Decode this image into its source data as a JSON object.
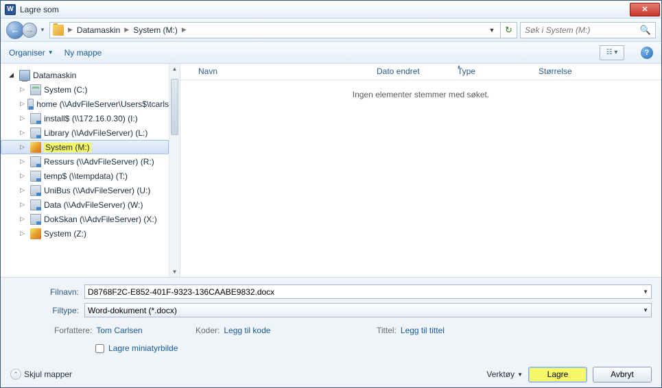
{
  "window": {
    "title": "Lagre som",
    "app_icon_letter": "W"
  },
  "nav": {
    "breadcrumb": [
      "Datamaskin",
      "System (M:)"
    ],
    "search_placeholder": "Søk i System (M:)"
  },
  "toolbar": {
    "organize": "Organiser",
    "new_folder": "Ny mappe"
  },
  "tree": {
    "root": "Datamaskin",
    "items": [
      {
        "label": "System (C:)",
        "icon": "drive"
      },
      {
        "label": "home (\\\\AdvFileServer\\Users$\\tcarls",
        "icon": "netdrive"
      },
      {
        "label": "install$ (\\\\172.16.0.30) (I:)",
        "icon": "netdrive"
      },
      {
        "label": "Library (\\\\AdvFileServer) (L:)",
        "icon": "netdrive"
      },
      {
        "label": "System (M:)",
        "icon": "sys",
        "selected": true
      },
      {
        "label": "Ressurs (\\\\AdvFileServer) (R:)",
        "icon": "netdrive"
      },
      {
        "label": "temp$ (\\\\tempdata) (T:)",
        "icon": "netdrive"
      },
      {
        "label": "UniBus (\\\\AdvFileServer) (U:)",
        "icon": "netdrive"
      },
      {
        "label": "Data (\\\\AdvFileServer) (W:)",
        "icon": "netdrive"
      },
      {
        "label": "DokSkan (\\\\AdvFileServer) (X:)",
        "icon": "netdrive"
      },
      {
        "label": "System (Z:)",
        "icon": "sys"
      }
    ]
  },
  "list": {
    "columns": {
      "name": "Navn",
      "date": "Dato endret",
      "type": "Type",
      "size": "Størrelse"
    },
    "empty_text": "Ingen elementer stemmer med søket."
  },
  "form": {
    "filename_label": "Filnavn:",
    "filename_value": "D8768F2C-E852-401F-9323-136CAABE9832.docx",
    "filetype_label": "Filtype:",
    "filetype_value": "Word-dokument (*.docx)",
    "authors_label": "Forfattere:",
    "authors_value": "Tom Carlsen",
    "tags_label": "Koder:",
    "tags_value": "Legg til kode",
    "title_meta_label": "Tittel:",
    "title_meta_value": "Legg til tittel",
    "thumb_label": "Lagre miniatyrbilde"
  },
  "footer": {
    "hide_folders": "Skjul mapper",
    "tools": "Verktøy",
    "save": "Lagre",
    "cancel": "Avbryt"
  }
}
